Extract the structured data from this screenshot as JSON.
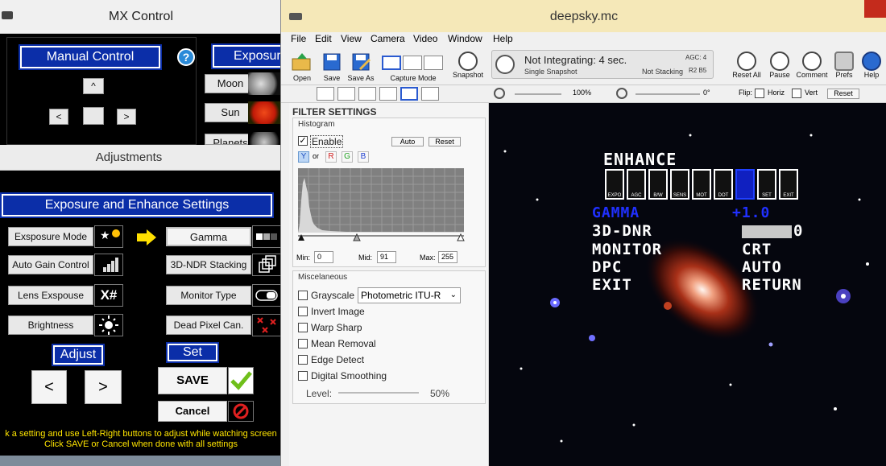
{
  "mx": {
    "title": "MX Control",
    "manual_control": "Manual Control",
    "help_icon": "?",
    "exposure_tab": "Exposur",
    "nav": {
      "up": "^",
      "left": "<",
      "right": ">"
    },
    "targets": [
      "Moon",
      "Sun",
      "Planets"
    ],
    "adjustments_title": "Adjustments",
    "settings_header": "Exposure and Enhance  Settings",
    "left_settings": [
      "Exsposure Mode",
      "Auto Gain Control",
      "Lens Exspouse",
      "Brightness"
    ],
    "right_settings": [
      "Gamma",
      "3D-NDR Stacking",
      "Monitor Type",
      "Dead  Pixel Can."
    ],
    "adjust_label": "Adjust",
    "set_label": "Set",
    "prev": "<",
    "next": ">",
    "save": "SAVE",
    "cancel": "Cancel",
    "help_line1": "k a setting and use Left-Right buttons to adjust while watching screen",
    "help_line2": "Click SAVE or Cancel when done with all settings",
    "icon_hash": "X#"
  },
  "ds": {
    "title": "deepsky.mc",
    "menu": [
      "File",
      "Edit",
      "View",
      "Camera",
      "Video",
      "Window",
      "Help"
    ],
    "toolbar": {
      "open": "Open",
      "save": "Save",
      "save_as": "Save As",
      "capture_mode": "Capture Mode",
      "snapshot": "Snapshot",
      "reset_all": "Reset All",
      "pause": "Pause",
      "comment": "Comment",
      "prefs": "Prefs",
      "help": "Help"
    },
    "status": {
      "main": "Not Integrating: 4 sec.",
      "sub": "Single Snapshot",
      "stacking": "Not Stacking",
      "agc": "AGC: 4",
      "r2b5": "R2 B5"
    },
    "subbar": {
      "zoom": "100%",
      "rotation": "0°",
      "flip": "Flip:",
      "horiz": "Horiz",
      "vert": "Vert",
      "reset": "Reset"
    },
    "filter": {
      "heading": "FILTER SETTINGS",
      "histogram": "Histogram",
      "enable": "Enable",
      "auto": "Auto",
      "reset": "Reset",
      "channels": [
        "Y",
        "R",
        "G",
        "B"
      ],
      "or": "or",
      "min_label": "Min:",
      "min": "0",
      "mid_label": "Mid:",
      "mid": "91",
      "max_label": "Max:",
      "max": "255",
      "misc": "Miscelaneous",
      "grayscale": "Grayscale",
      "grayscale_mode": "Photometric ITU-R",
      "options": [
        "Invert Image",
        "Warp Sharp",
        "Mean Removal",
        "Edge Detect",
        "Digital Smoothing"
      ],
      "level_label": "Level:",
      "level_value": "50%"
    },
    "osd": {
      "title": "ENHANCE",
      "icon_labels": [
        "EXPO",
        "AGC",
        "B/W",
        "SENS",
        "MOT",
        "DOT",
        "",
        "SET",
        "EXIT"
      ],
      "gamma": "GAMMA",
      "gamma_value": "+1.0",
      "rows": [
        "3D-DNR",
        "MONITOR",
        "DPC",
        "EXIT"
      ],
      "values": [
        "0",
        "CRT",
        "AUTO",
        "RETURN"
      ]
    }
  }
}
